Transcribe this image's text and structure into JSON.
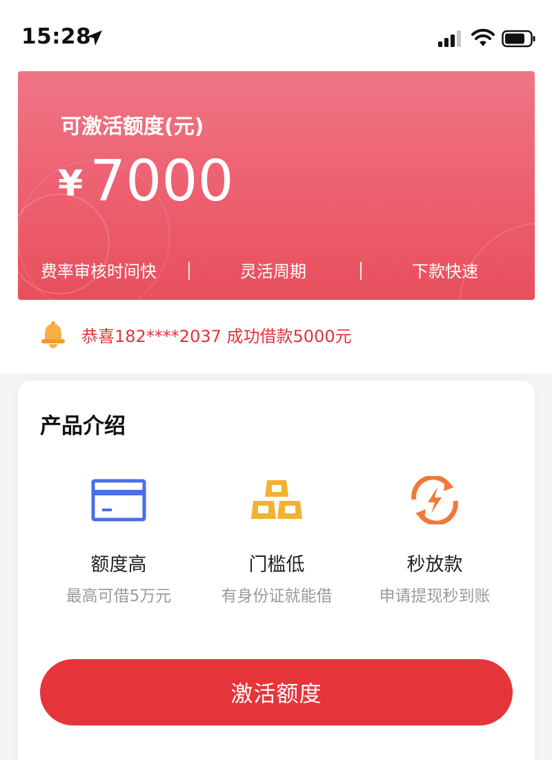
{
  "status_bar": {
    "time": "15:28",
    "icons": [
      "location-arrow-icon",
      "signal-icon",
      "wifi-icon",
      "battery-icon"
    ]
  },
  "hero": {
    "title": "可激活额度(元)",
    "currency": "¥",
    "amount": "7000",
    "features": [
      "费率审核时间快",
      "灵活周期",
      "下款快速"
    ],
    "colors": {
      "gradient_top": "#ef7686",
      "gradient_bottom": "#e84f5d"
    }
  },
  "notice": {
    "icon": "bell-icon",
    "text": "恭喜182****2037 成功借款5000元",
    "color": "#e0323a"
  },
  "product": {
    "title": "产品介绍",
    "features": [
      {
        "icon": "card-icon",
        "name": "额度高",
        "desc": "最高可借5万元",
        "color": "#4a6ee8"
      },
      {
        "icon": "gold-bars-icon",
        "name": "门槛低",
        "desc": "有身份证就能借",
        "color": "#f2b230"
      },
      {
        "icon": "lightning-cycle-icon",
        "name": "秒放款",
        "desc": "申请提现秒到账",
        "color": "#ee7a3a"
      }
    ],
    "button_label": "激活额度",
    "button_color": "#e5353a"
  }
}
